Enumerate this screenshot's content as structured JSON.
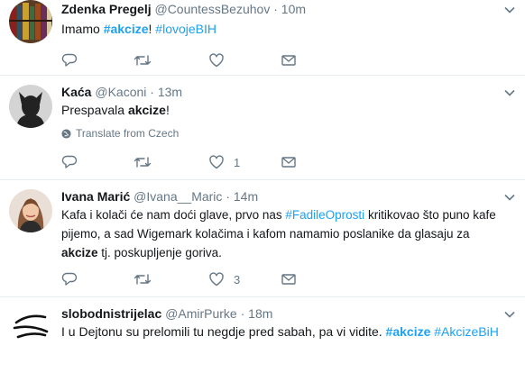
{
  "tweets": [
    {
      "name": "Zdenka Pregelj",
      "handle": "@CountessBezuhov",
      "sep": "·",
      "time": "10m",
      "text": {
        "t1": "Imamo ",
        "h1": "#akcize",
        "t2": "! ",
        "h2": "#lovojeBIH"
      },
      "like_count": ""
    },
    {
      "name": "Kaća",
      "handle": "@Kaconi",
      "sep": "·",
      "time": "13m",
      "text": {
        "t1": "Prespavala ",
        "b1": "akcize",
        "t2": "!"
      },
      "translate": "Translate from Czech",
      "like_count": "1"
    },
    {
      "name": "Ivana Marić",
      "handle": "@Ivana__Maric",
      "sep": "·",
      "time": "14m",
      "text": {
        "l1a": "Kafa i kolači će nam doći glave, prvo nas ",
        "l1h": "#FadileOprosti",
        "l1b": " kritikovao što puno kafe",
        "l2": "pijemo, a sad Wigemark kolačima i kafom namamio poslanike da glasaju za",
        "l3b": "akcize",
        "l3": " tj. poskupljenje goriva."
      },
      "like_count": "3"
    },
    {
      "name": "slobodnistrijelac",
      "handle": "@AmirPurke",
      "sep": "·",
      "time": "18m",
      "text": {
        "t1": "I u Dejtonu su prelomili tu negdje pred sabah, pa vi vidite. ",
        "h1": "#akcize",
        "t2": " ",
        "h2": "#AkcizeBiH"
      }
    }
  ],
  "colors": {
    "link": "#1da1f2",
    "muted": "#657786",
    "border": "#e6ecf0"
  },
  "icons": [
    "reply-icon",
    "retweet-icon",
    "like-icon",
    "direct-message-icon",
    "chevron-down-icon",
    "globe-icon"
  ]
}
